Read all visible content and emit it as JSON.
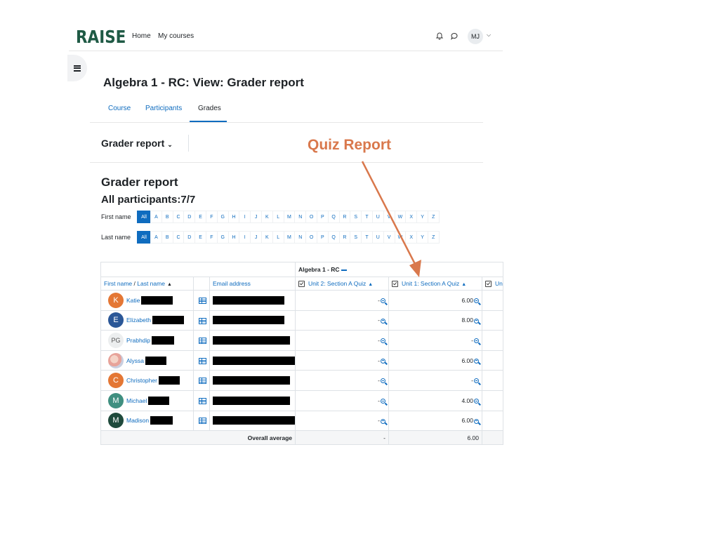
{
  "brand": {
    "logo": "RAISE"
  },
  "nav": {
    "home": "Home",
    "my_courses": "My courses",
    "user_initials": "MJ"
  },
  "page": {
    "title": "Algebra 1 - RC: View: Grader report",
    "tabs": [
      "Course",
      "Participants",
      "Grades"
    ],
    "active_tab": "Grades",
    "report_select": "Grader report",
    "report_heading": "Grader report",
    "participants_heading": "All participants:7/7"
  },
  "initials": {
    "first_label": "First name",
    "last_label": "Last name",
    "all": "All",
    "letters": [
      "A",
      "B",
      "C",
      "D",
      "E",
      "F",
      "G",
      "H",
      "I",
      "J",
      "K",
      "L",
      "M",
      "N",
      "O",
      "P",
      "Q",
      "R",
      "S",
      "T",
      "U",
      "V",
      "W",
      "X",
      "Y",
      "Z"
    ]
  },
  "table": {
    "course_header": "Algebra 1 - RC",
    "col_first": "First name",
    "col_sep": " / ",
    "col_last": "Last name",
    "col_email": "Email address",
    "col_q2": "Unit 2: Section A Quiz",
    "col_q1": "Unit 1: Section A Quiz",
    "col_next": "Un",
    "rows": [
      {
        "initial": "K",
        "avatar_color": "#e47735",
        "name": "Katie",
        "q2": "-",
        "q1": "6.00"
      },
      {
        "initial": "E",
        "avatar_color": "#2b5797",
        "name": "Elizabeth",
        "q2": "-",
        "q1": "8.00"
      },
      {
        "initial": "PG",
        "avatar_color": "#eceeef",
        "name": "Prabhdip",
        "q2": "-",
        "q1": "-"
      },
      {
        "initial": "",
        "avatar_color": "photo",
        "name": "Alyssa",
        "q2": "-",
        "q1": "6.00"
      },
      {
        "initial": "C",
        "avatar_color": "#e47735",
        "name": "Christopher",
        "q2": "-",
        "q1": "-"
      },
      {
        "initial": "M",
        "avatar_color": "#3f8f80",
        "name": "Michael",
        "q2": "-",
        "q1": "4.00"
      },
      {
        "initial": "M",
        "avatar_color": "#1f4a3c",
        "name": "Madison",
        "q2": "-",
        "q1": "6.00"
      }
    ],
    "overall_label": "Overall average",
    "overall_q2": "-",
    "overall_q1": "6.00"
  },
  "annotation": {
    "text": "Quiz Report",
    "color": "#d9784c"
  }
}
